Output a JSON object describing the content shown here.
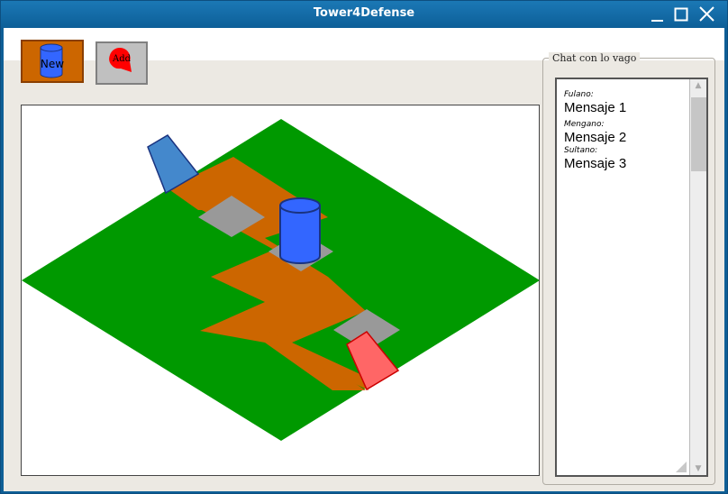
{
  "window": {
    "title": "Tower4Defense",
    "controls": [
      "minimize",
      "maximize",
      "close"
    ]
  },
  "toolbar": {
    "new_button": {
      "label": "New",
      "icon": "cylinder-tower-icon",
      "color": "#cc6600"
    },
    "add_button": {
      "label": "Add",
      "icon": "red-drop-icon",
      "color": "#c0c0c0"
    }
  },
  "board": {
    "grass_color": "#009900",
    "path_color": "#cc6600",
    "slot_color": "#999999",
    "tower_color": "#3366ff",
    "entry_color": "#4488cc",
    "exit_color": "#ff6666"
  },
  "chat": {
    "title": "Chat con lo vago",
    "messages": [
      {
        "author": "Fulano:",
        "text": "Mensaje 1"
      },
      {
        "author": "Mengano:",
        "text": "Mensaje 2"
      },
      {
        "author": "Sultano:",
        "text": "Mensaje 3"
      }
    ]
  }
}
